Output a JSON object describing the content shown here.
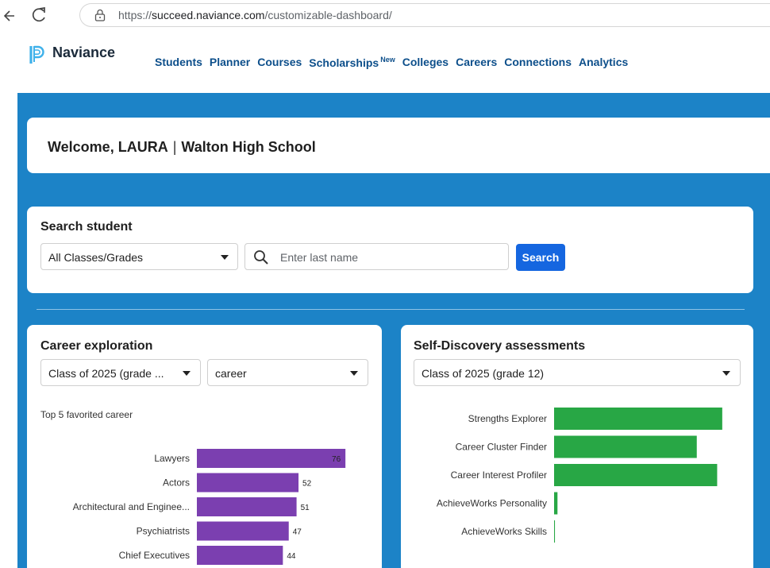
{
  "browser": {
    "url_prefix": "https://",
    "url_domain": "succeed.naviance.com",
    "url_path": "/customizable-dashboard/"
  },
  "header": {
    "logo": "Naviance",
    "nav": [
      {
        "label": "Students"
      },
      {
        "label": "Planner"
      },
      {
        "label": "Courses"
      },
      {
        "label": "Scholarships",
        "badge": "New"
      },
      {
        "label": "Colleges"
      },
      {
        "label": "Careers"
      },
      {
        "label": "Connections"
      },
      {
        "label": "Analytics"
      }
    ]
  },
  "welcome": {
    "greeting": "Welcome, LAURA",
    "separator": "|",
    "school": "Walton High School"
  },
  "search": {
    "title": "Search student",
    "class_select": "All Classes/Grades",
    "placeholder": "Enter last name",
    "button": "Search"
  },
  "career": {
    "title": "Career exploration",
    "class_select": "Class of 2025 (grade ...",
    "type_select": "career",
    "subtitle": "Top 5 favorited career"
  },
  "self_discovery": {
    "title": "Self-Discovery assessments",
    "class_select": "Class of 2025 (grade 12)"
  },
  "colors": {
    "blue_bg": "#1c83c7",
    "nav_link": "#0d4f8b",
    "button": "#1566e0",
    "purple_bar": "#7b3fb0",
    "green_bar": "#28a745"
  },
  "chart_data": [
    {
      "type": "bar",
      "orientation": "horizontal",
      "categories": [
        "Lawyers",
        "Actors",
        "Architectural and Enginee...",
        "Psychiatrists",
        "Chief Executives"
      ],
      "values": [
        76,
        52,
        51,
        47,
        44
      ],
      "data_labels": true,
      "xlim": [
        0,
        80
      ]
    },
    {
      "type": "bar",
      "orientation": "horizontal",
      "categories": [
        "Strengths Explorer",
        "Career Cluster Finder",
        "Career Interest Profiler",
        "AchieveWorks Personality",
        "AchieveWorks Skills"
      ],
      "values": [
        99,
        84,
        96,
        2,
        0.5
      ],
      "data_labels": false,
      "xlim": [
        0,
        100
      ]
    }
  ]
}
